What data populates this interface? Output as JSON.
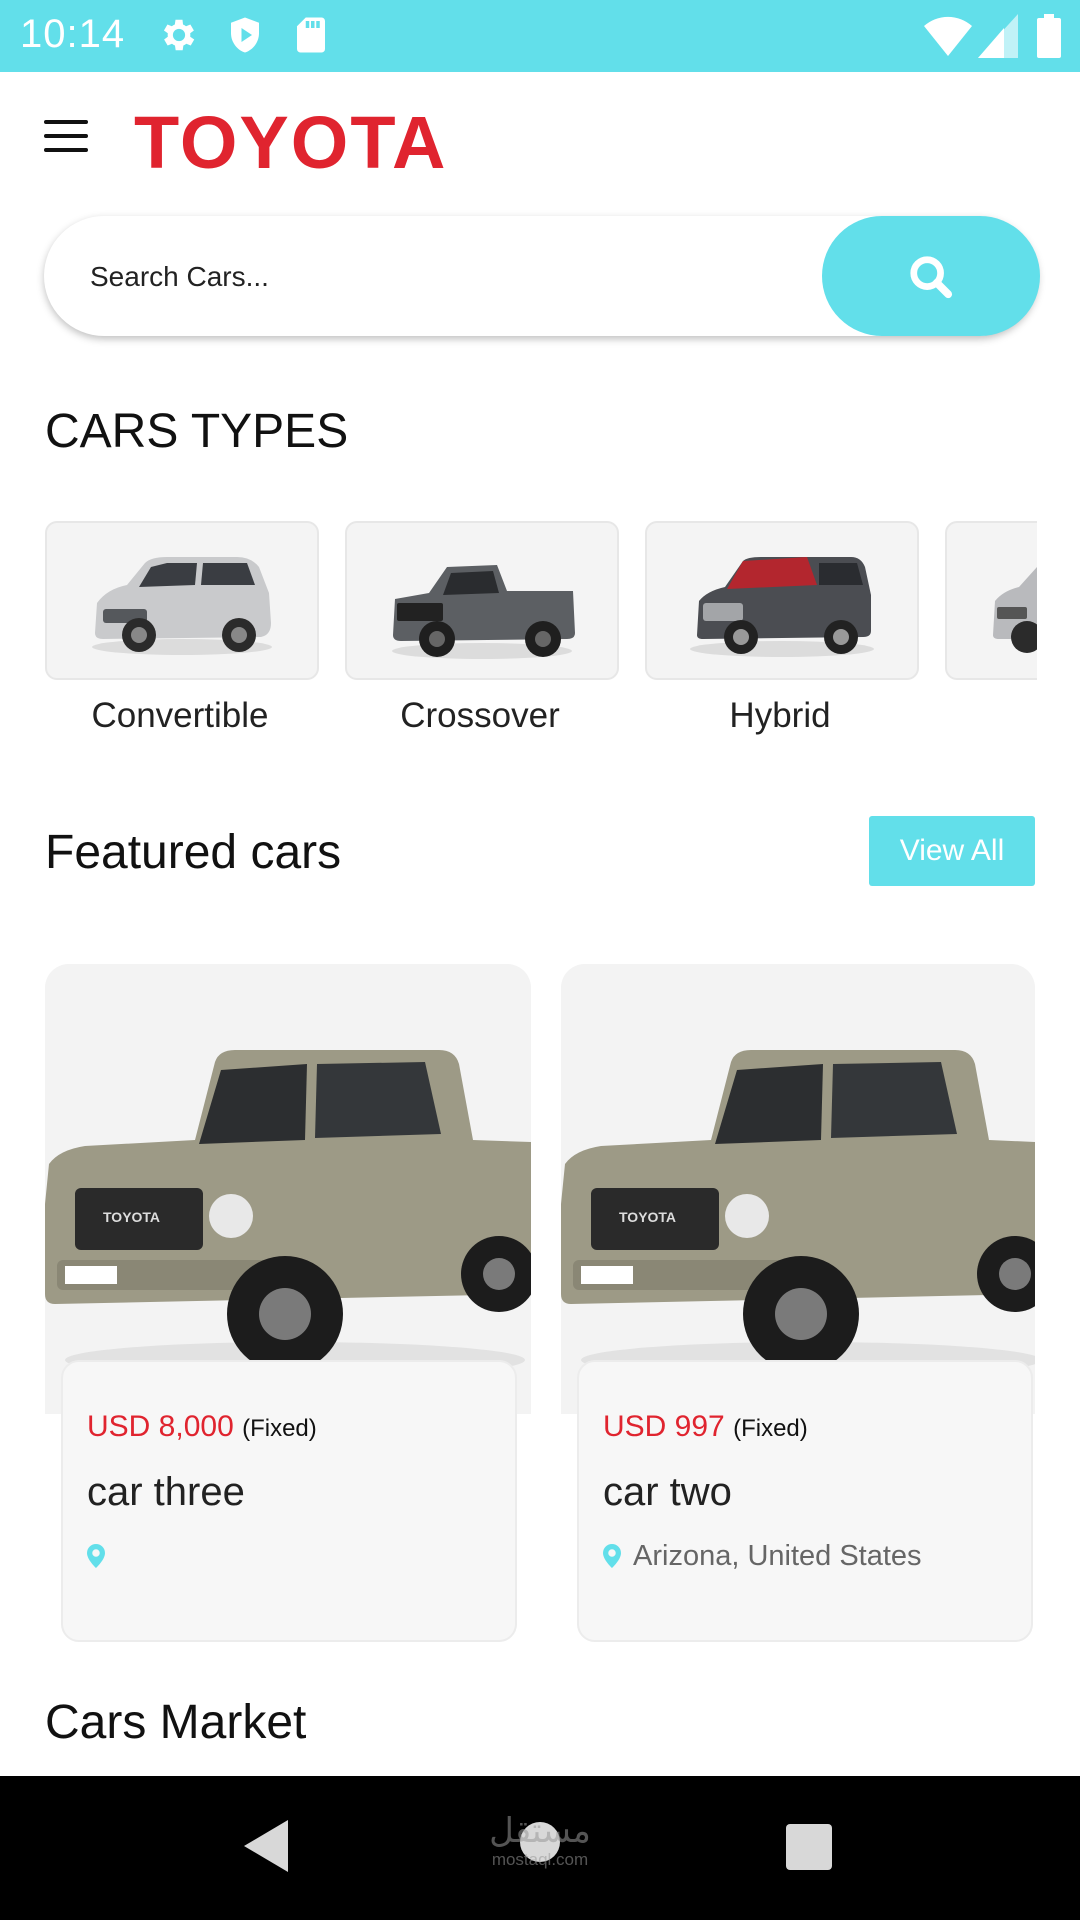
{
  "status_bar": {
    "time": "10:14",
    "color": "#62dfea"
  },
  "header": {
    "brand": "TOYOTA",
    "brand_color": "#e0242f",
    "menu_icon": "hamburger-icon"
  },
  "search": {
    "placeholder": "Search Cars...",
    "value": "",
    "button_icon": "search-icon"
  },
  "car_types": {
    "title": "CARS TYPES",
    "items": [
      {
        "label": "Convertible"
      },
      {
        "label": "Crossover"
      },
      {
        "label": "Hybrid"
      },
      {
        "label": ""
      }
    ]
  },
  "featured": {
    "title": "Featured cars",
    "view_all_label": "View All",
    "cars": [
      {
        "price": "USD 8,000",
        "price_note": "(Fixed)",
        "name": "car three",
        "location": ""
      },
      {
        "price": "USD 997",
        "price_note": "(Fixed)",
        "name": "car two",
        "location": "Arizona, United States"
      }
    ]
  },
  "market": {
    "title": "Cars Market"
  },
  "accent_color": "#62dfea",
  "watermark": {
    "text": "مستقل",
    "subtext": "mostaql.com"
  }
}
